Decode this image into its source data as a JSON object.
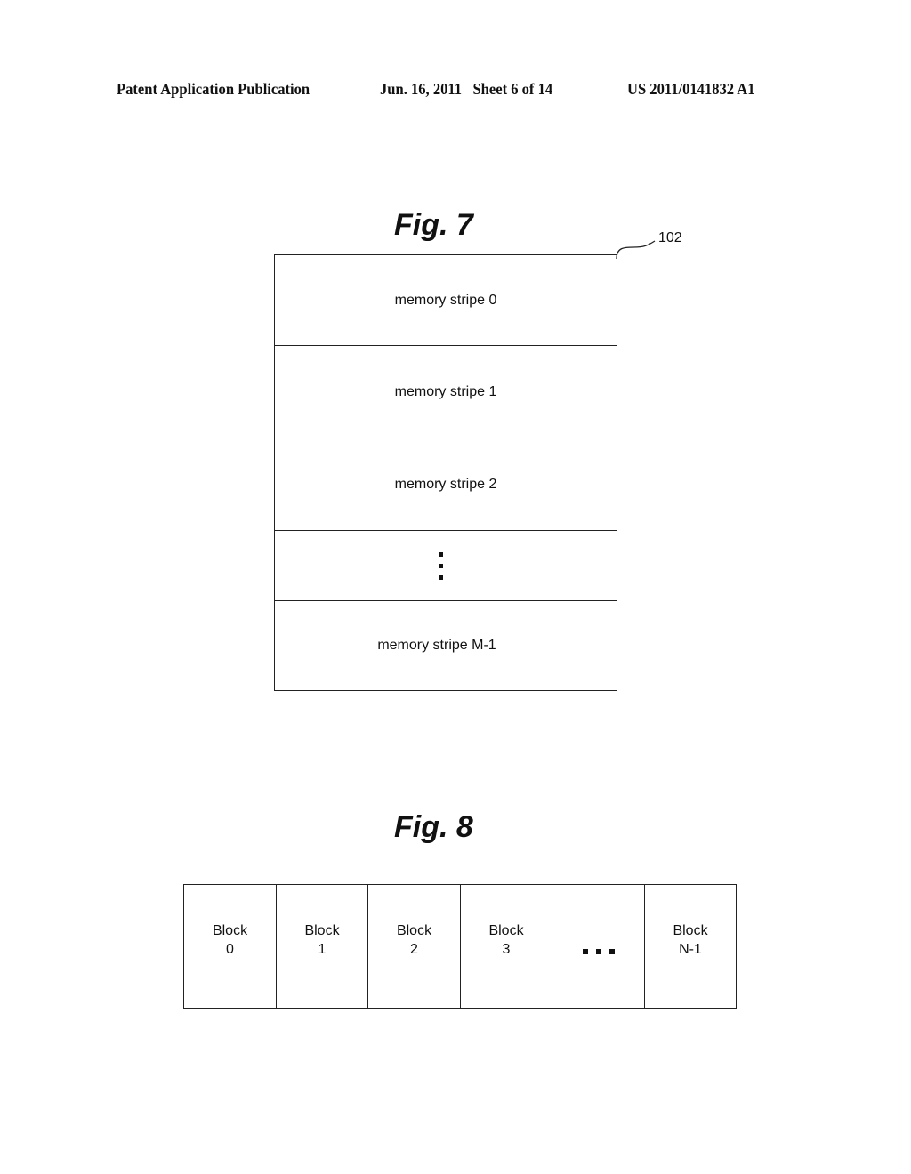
{
  "header": {
    "publication": "Patent Application Publication",
    "date_sheet": "Jun. 16, 2011   Sheet 6 of 14",
    "number": "US 2011/0141832 A1"
  },
  "fig7": {
    "title": "Fig. 7",
    "reference": "102",
    "stripes": [
      {
        "label": "memory stripe 0"
      },
      {
        "label": "memory stripe 1"
      },
      {
        "label": "memory stripe 2"
      },
      {
        "label": "",
        "ellipsis": "vertical"
      },
      {
        "label": "memory stripe M-1"
      }
    ]
  },
  "fig8": {
    "title": "Fig. 8",
    "blocks": [
      {
        "line1": "Block",
        "line2": "0"
      },
      {
        "line1": "Block",
        "line2": "1"
      },
      {
        "line1": "Block",
        "line2": "2"
      },
      {
        "line1": "Block",
        "line2": "3"
      },
      {
        "line1": "",
        "line2": "",
        "ellipsis": "horizontal"
      },
      {
        "line1": "Block",
        "line2": "N-1"
      }
    ]
  }
}
